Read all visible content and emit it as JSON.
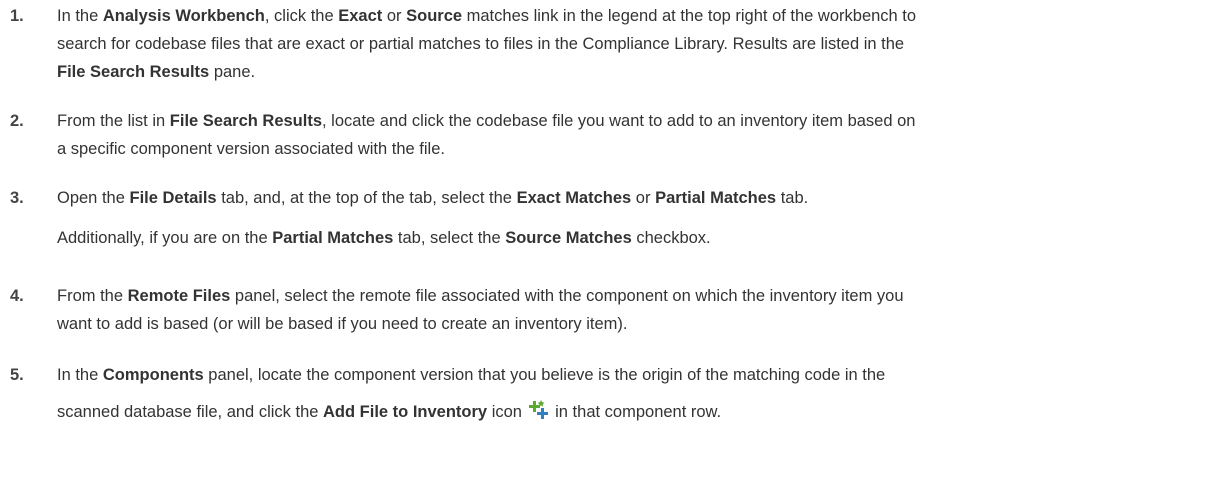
{
  "steps": [
    {
      "number": "1.",
      "lines": [
        [
          {
            "text": "In the ",
            "bold": false
          },
          {
            "text": "Analysis Workbench",
            "bold": true
          },
          {
            "text": ", click the ",
            "bold": false
          },
          {
            "text": "Exact",
            "bold": true
          },
          {
            "text": " or ",
            "bold": false
          },
          {
            "text": "Source",
            "bold": true
          },
          {
            "text": " matches link in the legend at the top right of the workbench to",
            "bold": false
          }
        ],
        [
          {
            "text": "search for codebase files that are exact or partial matches to files in the Compliance Library. Results are listed in the",
            "bold": false
          }
        ],
        [
          {
            "text": "File Search Results",
            "bold": true
          },
          {
            "text": " pane.",
            "bold": false
          }
        ]
      ]
    },
    {
      "number": "2.",
      "lines": [
        [
          {
            "text": "From the list in ",
            "bold": false
          },
          {
            "text": "File Search Results",
            "bold": true
          },
          {
            "text": ", locate and click the codebase file you want to add to an inventory item based on",
            "bold": false
          }
        ],
        [
          {
            "text": "a specific component version associated with the file.",
            "bold": false
          }
        ]
      ]
    },
    {
      "number": "3.",
      "lines": [
        [
          {
            "text": "Open the ",
            "bold": false
          },
          {
            "text": "File Details",
            "bold": true
          },
          {
            "text": " tab, and, at the top of the tab, select the ",
            "bold": false
          },
          {
            "text": "Exact Matches",
            "bold": true
          },
          {
            "text": " or ",
            "bold": false
          },
          {
            "text": "Partial Matches",
            "bold": true
          },
          {
            "text": " tab.",
            "bold": false
          }
        ]
      ],
      "note": [
        {
          "text": "Additionally, if you are on the ",
          "bold": false
        },
        {
          "text": "Partial Matches",
          "bold": true
        },
        {
          "text": " tab, select the ",
          "bold": false
        },
        {
          "text": "Source Matches",
          "bold": true
        },
        {
          "text": " checkbox.",
          "bold": false
        }
      ]
    },
    {
      "number": "4.",
      "lines": [
        [
          {
            "text": "From the ",
            "bold": false
          },
          {
            "text": "Remote Files",
            "bold": true
          },
          {
            "text": " panel, select the remote file associated with the component on which the inventory item you",
            "bold": false
          }
        ],
        [
          {
            "text": "want to add is based (or will be based if you need to create an inventory item).",
            "bold": false
          }
        ]
      ]
    },
    {
      "number": "5.",
      "lines": [
        [
          {
            "text": "In the ",
            "bold": false
          },
          {
            "text": "Components",
            "bold": true
          },
          {
            "text": " panel, locate the component version that you believe is the origin of the matching code in the",
            "bold": false
          }
        ],
        [
          {
            "text": "scanned database file, and click the ",
            "bold": false
          },
          {
            "text": "Add File to Inventory",
            "bold": true
          },
          {
            "text": " icon ",
            "bold": false
          },
          {
            "icon": "add-file-to-inventory-icon"
          },
          {
            "text": " in that component row.",
            "bold": false
          }
        ]
      ]
    }
  ],
  "colors": {
    "text": "#333333",
    "icon_green": "#5ea92f",
    "icon_blue": "#2f7fc1"
  }
}
